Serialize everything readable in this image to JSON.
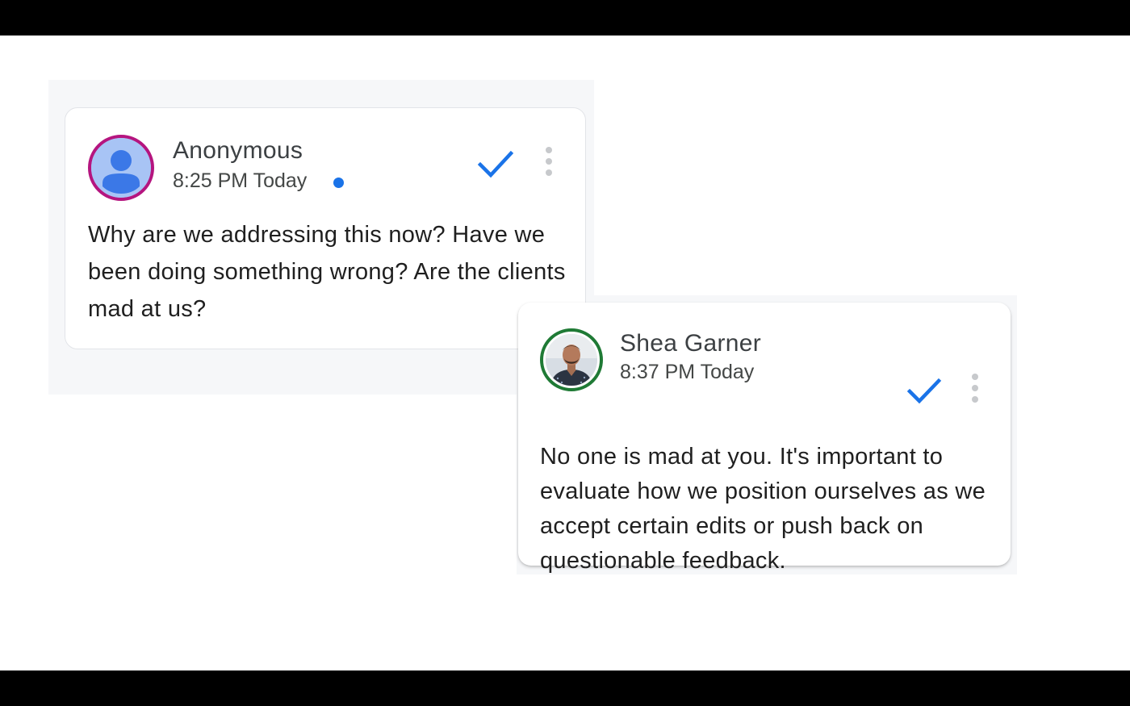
{
  "comments": [
    {
      "author": "Anonymous",
      "time": "8:25 PM Today",
      "unread": true,
      "avatar": "anonymous-user-icon",
      "avatar_ring_color": "#b5157f",
      "resolved_icon": "checkmark-icon",
      "menu_icon": "more-vert-icon",
      "text": "Why are we addressing this now? Have we been doing something wrong? Are the clients mad at us?"
    },
    {
      "author": "Shea Garner",
      "time": "8:37 PM Today",
      "unread": false,
      "avatar": "user-photo",
      "avatar_ring_color": "#1f7a35",
      "resolved_icon": "checkmark-icon",
      "menu_icon": "more-vert-icon",
      "text": "No one is mad at you. It's important to evaluate how we position ourselves as we accept certain edits or push back on questionable feedback."
    }
  ],
  "colors": {
    "accent": "#1a73e8",
    "unread_dot": "#1a73e8"
  }
}
